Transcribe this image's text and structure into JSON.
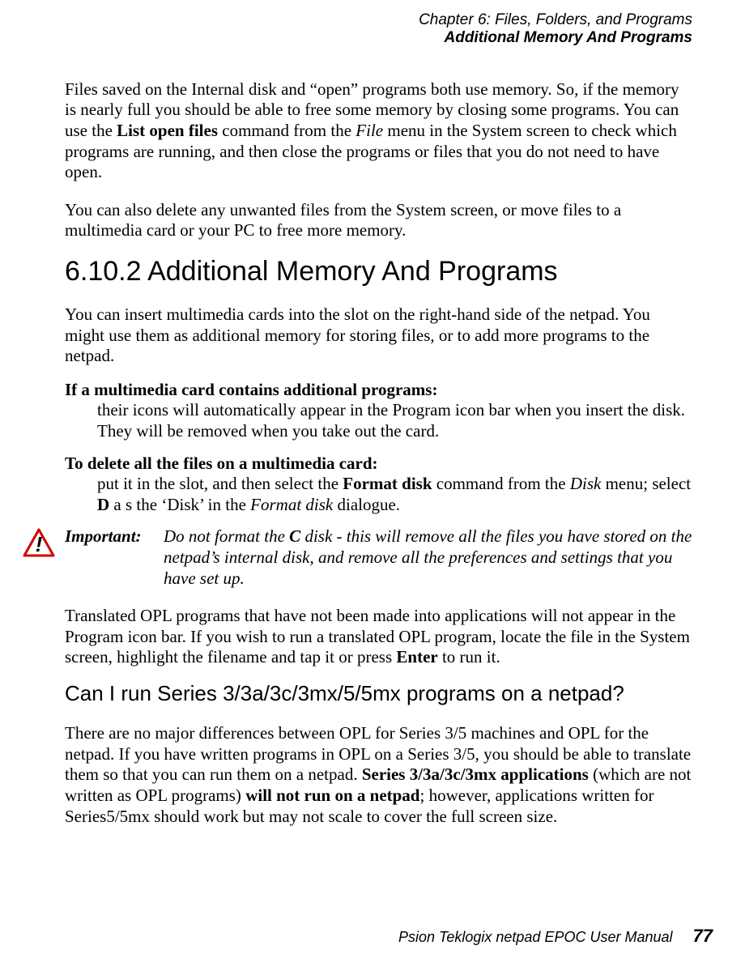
{
  "header": {
    "chapter_line": "Chapter 6:  Files, Folders, and Programs",
    "section_line": "Additional Memory And Programs"
  },
  "para1": {
    "t1": "Files saved on the Internal disk and “open” programs both use memory. So, if the memory is nearly full you should be able to free some memory by closing some programs. You can use the ",
    "b1": "List open files",
    "t2": " command from the ",
    "i1": "File",
    "t3": " menu in the System screen to check which programs are running, and then close the programs or files that you do not need to have open."
  },
  "para2": "You can also delete any unwanted files from the System screen, or move files to a multimedia card or your PC to free more memory.",
  "heading_6102": "6.10.2  Additional Memory And Programs",
  "para3": "You can insert multimedia cards into the slot on the right-hand side of the netpad. You might use them as additional memory for storing files, or to add more programs to the netpad.",
  "def1": {
    "title": "If a multimedia card contains additional programs:",
    "body": "their icons will automatically appear in the Program icon bar when you insert the disk. They will be removed when you take out the card."
  },
  "def2": {
    "title": "To delete all the files on a multimedia card:",
    "body_t1": "put it in the slot, and then select the ",
    "body_b1": "Format disk",
    "body_t2": " command from the ",
    "body_i1": "Disk",
    "body_t3": " menu; select ",
    "body_b2": "D",
    "body_t4": " a s the ‘Disk’ in the ",
    "body_i2": "Format disk",
    "body_t5": " dialogue."
  },
  "important": {
    "label": "Important:",
    "t1": "Do not format the ",
    "bi1": "C",
    "t2": " disk - this will remove all the files you have stored on the netpad’s internal disk, and remove all the preferences and settings that you have set up."
  },
  "para4": {
    "t1": "Translated OPL programs that have not been made into applications will not appear in the Program icon bar. If you wish to run a translated OPL program, locate the file in the System screen, highlight the filename and tap it or press ",
    "b1": "Enter",
    "t2": " to run it."
  },
  "subheading": "Can I run Series 3/3a/3c/3mx/5/5mx programs on a netpad?",
  "para5": {
    "t1": "There are no major differences between OPL for Series 3/5 machines and OPL for the netpad. If you have written programs in OPL on a Series 3/5, you should be able to translate them so that you can run them on a netpad. ",
    "b1": "Series 3/3a/3c/3mx applications",
    "t2": " (which are not written as OPL programs) ",
    "b2": "will not run on a netpad",
    "t3": "; however, applications written for Series5/5mx should work but may not scale to cover the full screen size."
  },
  "footer": {
    "manual": "Psion Teklogix netpad EPOC User Manual",
    "page": "77"
  }
}
